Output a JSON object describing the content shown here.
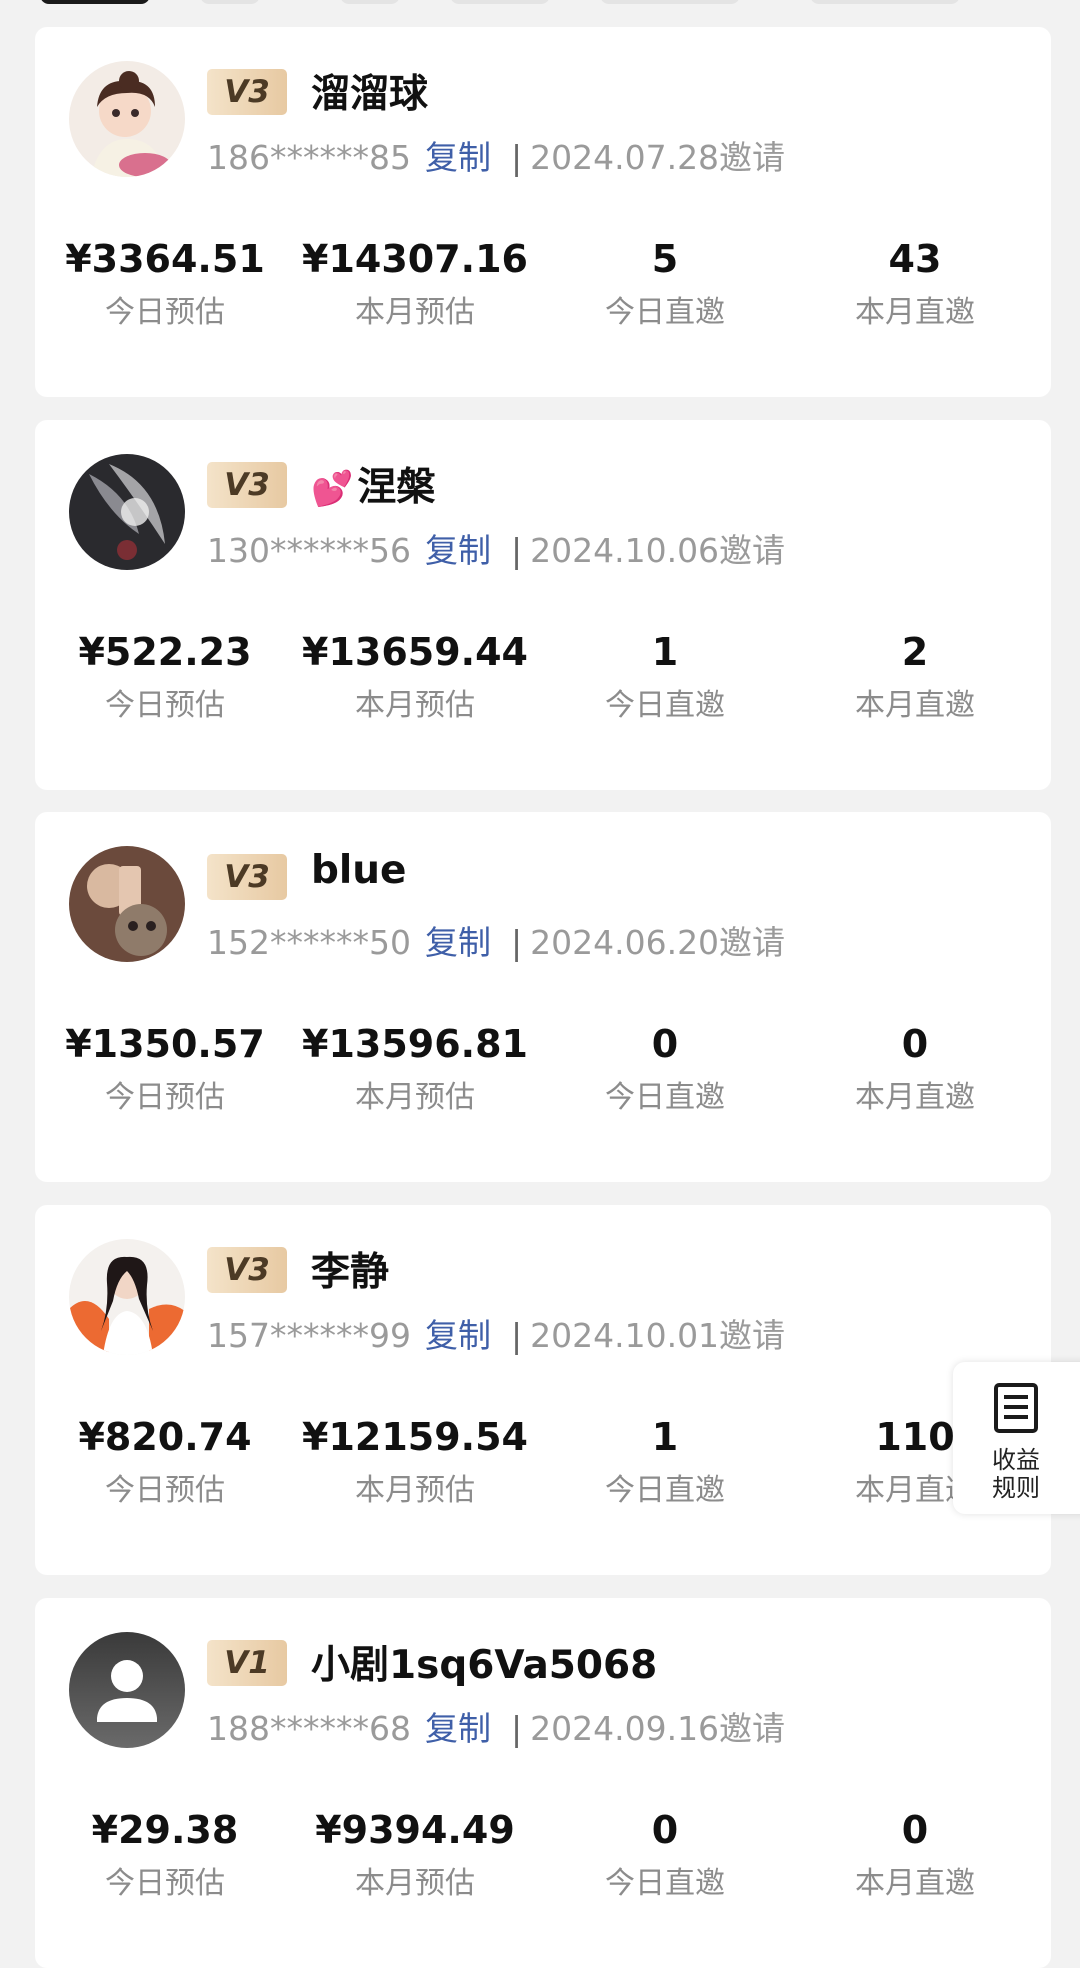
{
  "invites": [
    {
      "level": "V3",
      "name": "溜溜球",
      "name_prefix": "",
      "phone": "186******85",
      "copy_label": "复制",
      "separator": "|",
      "invite_date": "2024.07.28邀请",
      "avatar_icon": "girl-cartoon-avatar",
      "stats": [
        {
          "value": "¥3364.51",
          "label": "今日预估"
        },
        {
          "value": "¥14307.16",
          "label": "本月预估"
        },
        {
          "value": "5",
          "label": "今日直邀"
        },
        {
          "value": "43",
          "label": "本月直邀"
        }
      ]
    },
    {
      "level": "V3",
      "name": "涅槃",
      "name_prefix": "💕",
      "phone": "130******56",
      "copy_label": "复制",
      "separator": "|",
      "invite_date": "2024.10.06邀请",
      "avatar_icon": "dark-art-avatar",
      "stats": [
        {
          "value": "¥522.23",
          "label": "今日预估"
        },
        {
          "value": "¥13659.44",
          "label": "本月预估"
        },
        {
          "value": "1",
          "label": "今日直邀"
        },
        {
          "value": "2",
          "label": "本月直邀"
        }
      ]
    },
    {
      "level": "V3",
      "name": "blue",
      "name_prefix": "",
      "phone": "152******50",
      "copy_label": "复制",
      "separator": "|",
      "invite_date": "2024.06.20邀请",
      "avatar_icon": "photo-avatar",
      "stats": [
        {
          "value": "¥1350.57",
          "label": "今日预估"
        },
        {
          "value": "¥13596.81",
          "label": "本月预估"
        },
        {
          "value": "0",
          "label": "今日直邀"
        },
        {
          "value": "0",
          "label": "本月直邀"
        }
      ]
    },
    {
      "level": "V3",
      "name": "李静",
      "name_prefix": "",
      "phone": "157******99",
      "copy_label": "复制",
      "separator": "|",
      "invite_date": "2024.10.01邀请",
      "avatar_icon": "woman-photo-avatar",
      "stats": [
        {
          "value": "¥820.74",
          "label": "今日预估"
        },
        {
          "value": "¥12159.54",
          "label": "本月预估"
        },
        {
          "value": "1",
          "label": "今日直邀"
        },
        {
          "value": "110",
          "label": "本月直邀"
        }
      ]
    },
    {
      "level": "V1",
      "name": "小剧1sq6Va5068",
      "name_prefix": "",
      "phone": "188******68",
      "copy_label": "复制",
      "separator": "|",
      "invite_date": "2024.09.16邀请",
      "avatar_icon": "default-user-avatar",
      "stats": [
        {
          "value": "¥29.38",
          "label": "今日预估"
        },
        {
          "value": "¥9394.49",
          "label": "本月预估"
        },
        {
          "value": "0",
          "label": "今日直邀"
        },
        {
          "value": "0",
          "label": "本月直邀"
        }
      ]
    }
  ],
  "float_button": {
    "icon": "document-list-icon",
    "line1": "收益",
    "line2": "规则"
  },
  "colors": {
    "background": "#f2f2f2",
    "card": "#ffffff",
    "copy_link": "#3f5fa8",
    "badge_gold": "#e7c9a2"
  }
}
